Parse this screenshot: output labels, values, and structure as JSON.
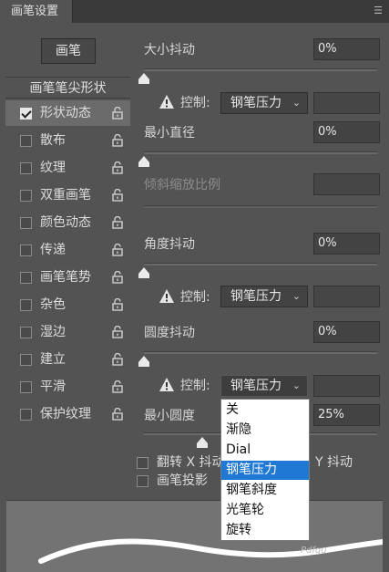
{
  "panel": {
    "tab_title": "画笔设置"
  },
  "brush_button": "画笔",
  "section_header": "画笔笔尖形状",
  "sidebar_items": [
    {
      "label": "形状动态",
      "checked": true,
      "selected": true
    },
    {
      "label": "散布",
      "checked": false
    },
    {
      "label": "纹理",
      "checked": false
    },
    {
      "label": "双重画笔",
      "checked": false
    },
    {
      "label": "颜色动态",
      "checked": false
    },
    {
      "label": "传递",
      "checked": false
    },
    {
      "label": "画笔笔势",
      "checked": false
    },
    {
      "label": "杂色",
      "checked": false
    },
    {
      "label": "湿边",
      "checked": false
    },
    {
      "label": "建立",
      "checked": false
    },
    {
      "label": "平滑",
      "checked": false
    },
    {
      "label": "保护纹理",
      "checked": false
    }
  ],
  "settings": {
    "size_jitter": {
      "label": "大小抖动",
      "value": "0%"
    },
    "size_control": {
      "label": "控制:",
      "selected": "钢笔压力"
    },
    "min_diameter": {
      "label": "最小直径",
      "value": "0%"
    },
    "tilt_scale": {
      "label": "倾斜缩放比例"
    },
    "angle_jitter": {
      "label": "角度抖动",
      "value": "0%"
    },
    "angle_control": {
      "label": "控制:",
      "selected": "钢笔压力"
    },
    "roundness_jitter": {
      "label": "圆度抖动",
      "value": "0%"
    },
    "roundness_control": {
      "label": "控制:",
      "selected": "钢笔压力"
    },
    "min_roundness": {
      "label": "最小圆度",
      "value": "25%"
    },
    "flip_x": {
      "label": "翻转 X 抖动"
    },
    "flip_y": {
      "label": "Y 抖动"
    },
    "brush_projection": {
      "label": "画笔投影"
    }
  },
  "dropdown_options": [
    "关",
    "渐隐",
    "Dial",
    "钢笔压力",
    "钢笔斜度",
    "光笔轮",
    "旋转"
  ],
  "dropdown_highlighted": "钢笔压力",
  "watermark": "Pdfqu"
}
